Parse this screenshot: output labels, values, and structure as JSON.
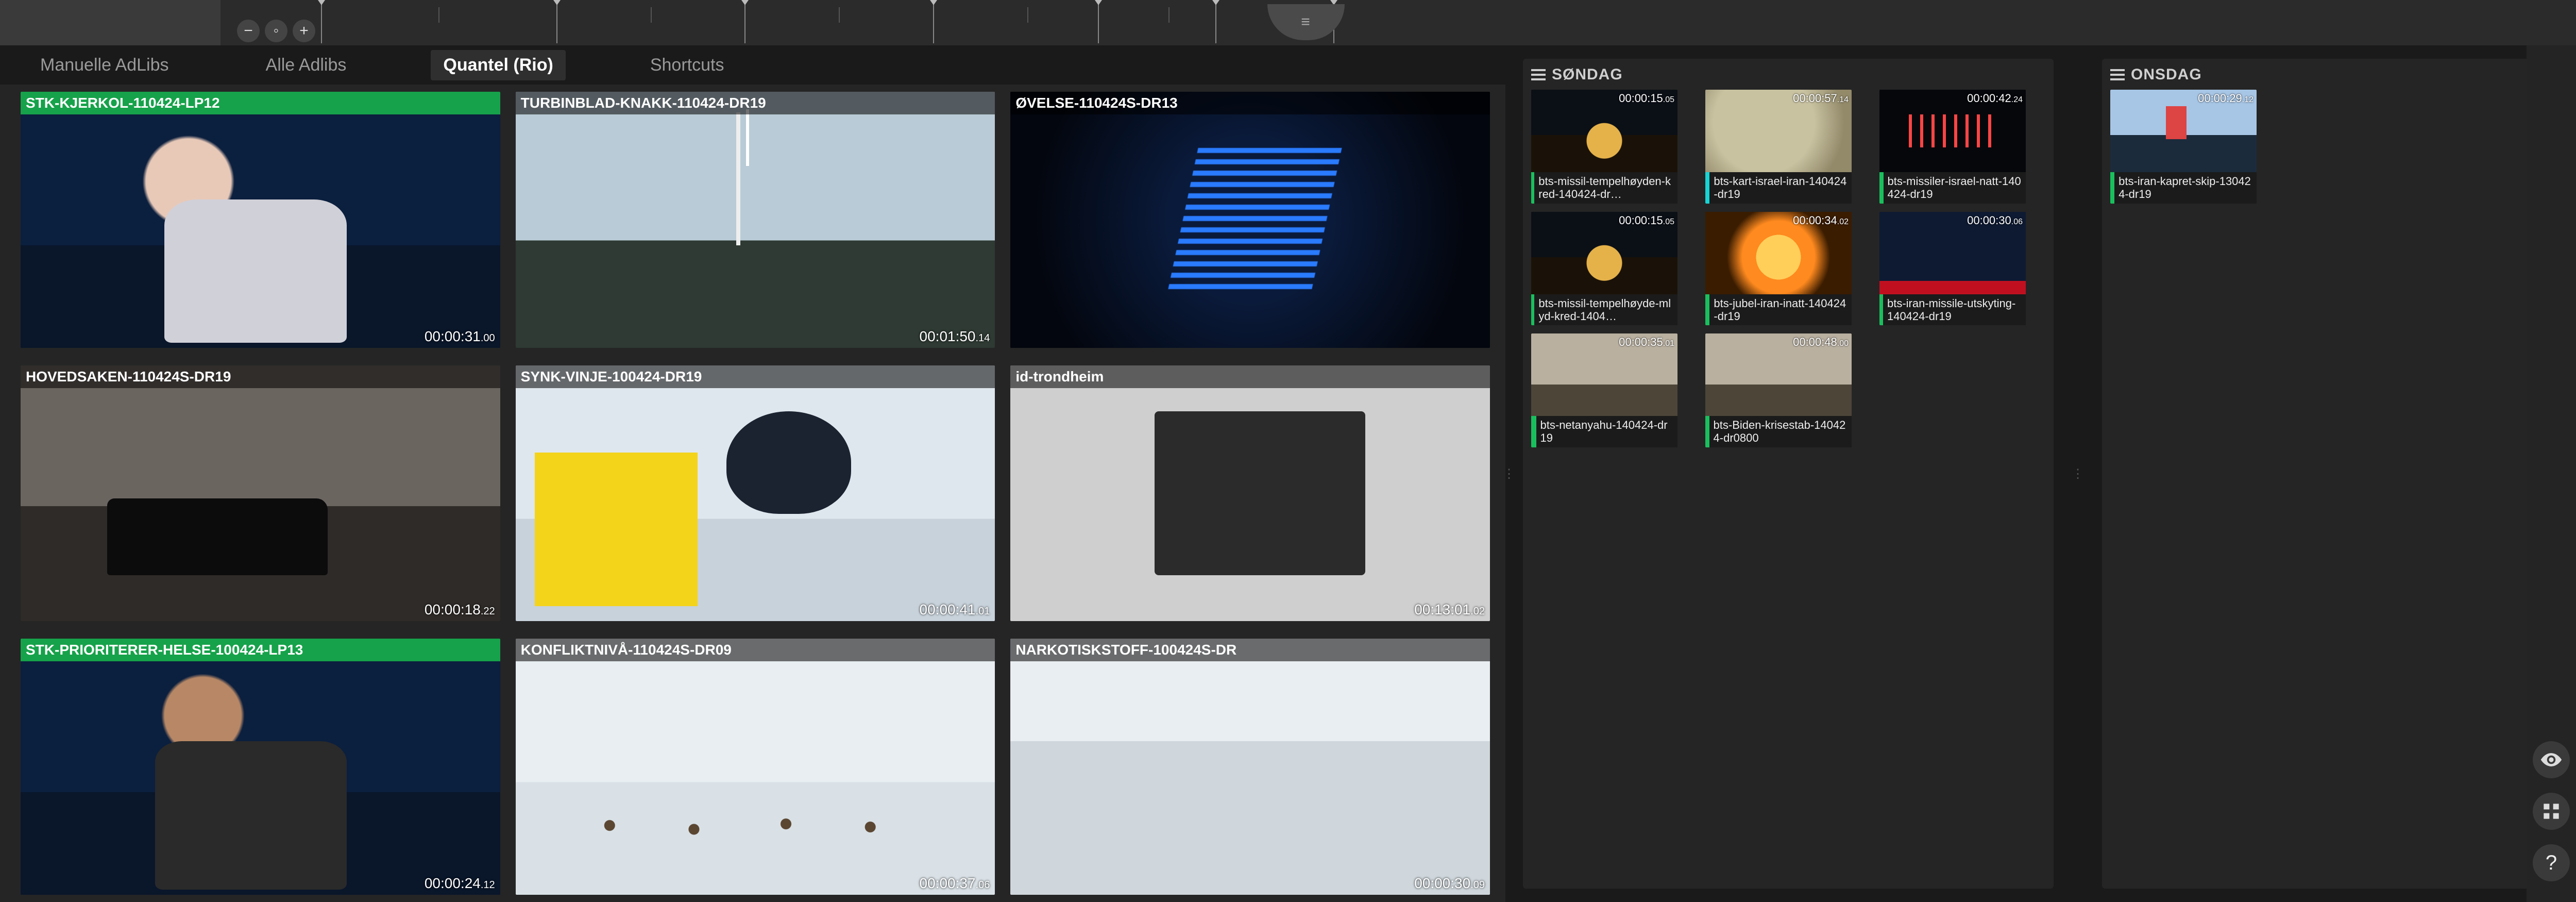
{
  "timeline": {
    "zoom_out": "−",
    "zoom_reset": "◦",
    "zoom_in": "+",
    "handle_glyph": "≡"
  },
  "tabs": [
    {
      "id": "manual",
      "label": "Manuelle AdLibs",
      "active": false
    },
    {
      "id": "all",
      "label": "Alle Adlibs",
      "active": false
    },
    {
      "id": "quantel",
      "label": "Quantel (Rio)",
      "active": true
    },
    {
      "id": "shortcut",
      "label": "Shortcuts",
      "active": false
    }
  ],
  "clips": [
    {
      "title": "STK-KJERKOL-110424-LP12",
      "dur": "00:00:31",
      "frames": ".00",
      "green": true,
      "art": "art-anchor1"
    },
    {
      "title": "TURBINBLAD-KNAKK-110424-DR19",
      "dur": "00:01:50",
      "frames": ".14",
      "green": false,
      "art": "art-wind"
    },
    {
      "title": "ØVELSE-110424S-DR13",
      "dur": "",
      "frames": "",
      "green": false,
      "art": "art-space"
    },
    {
      "title": "HOVEDSAKEN-110424S-DR19",
      "dur": "00:00:18",
      "frames": ".22",
      "green": false,
      "art": "art-car"
    },
    {
      "title": "SYNK-VINJE-100424-DR19",
      "dur": "00:00:41",
      "frames": ".01",
      "green": false,
      "art": "art-medic"
    },
    {
      "title": "id-trondheim",
      "dur": "00:13:01",
      "frames": ".02",
      "green": false,
      "art": "art-store"
    },
    {
      "title": "STK-PRIORITERER-HELSE-100424-LP13",
      "dur": "00:00:24",
      "frames": ".12",
      "green": true,
      "art": "art-anchor2"
    },
    {
      "title": "KONFLIKTNIVÅ-110424S-DR09",
      "dur": "00:00:37",
      "frames": ".06",
      "green": false,
      "art": "art-reindeer"
    },
    {
      "title": "NARKOTISKSTOFF-100424S-DR",
      "dur": "00:00:30",
      "frames": ".09",
      "green": false,
      "art": "art-drugs"
    }
  ],
  "bins": {
    "sunday": {
      "title": "SØNDAG",
      "items": [
        {
          "label": "bts-missil-tempelhøyden-kred-140424-dr…",
          "dur": "00:00:15",
          "frames": ".05",
          "stripe": "green",
          "art": "th-dome"
        },
        {
          "label": "bts-kart-israel-iran-140424-dr19",
          "dur": "00:00:57",
          "frames": ".14",
          "stripe": "cyan",
          "art": "th-map"
        },
        {
          "label": "bts-missiler-israel-natt-140424-dr19",
          "dur": "00:00:42",
          "frames": ".24",
          "stripe": "green",
          "art": "th-dark"
        },
        {
          "label": "bts-missil-tempelhøyde-mlyd-kred-1404…",
          "dur": "00:00:15",
          "frames": ".05",
          "stripe": "green",
          "art": "th-dome"
        },
        {
          "label": "bts-jubel-iran-inatt-140424-dr19",
          "dur": "00:00:34",
          "frames": ".02",
          "stripe": "green",
          "art": "th-fire"
        },
        {
          "label": "bts-iran-missile-utskyting-140424-dr19",
          "dur": "00:00:30",
          "frames": ".06",
          "stripe": "green",
          "art": "th-news"
        },
        {
          "label": "bts-netanyahu-140424-dr19",
          "dur": "00:00:35",
          "frames": ".01",
          "stripe": "green",
          "art": "th-room"
        },
        {
          "label": "bts-Biden-krisestab-140424-dr0800",
          "dur": "00:00:48",
          "frames": ".00",
          "stripe": "green",
          "art": "th-room"
        }
      ]
    },
    "wednesday": {
      "title": "ONSDAG",
      "items": [
        {
          "label": "bts-iran-kapret-skip-130424-dr19",
          "dur": "00:00:29",
          "frames": ".12",
          "stripe": "green",
          "art": "th-ship"
        }
      ]
    }
  },
  "rail": {
    "eye": "eye-icon",
    "arrange": "arrange-icon",
    "help": "?"
  }
}
